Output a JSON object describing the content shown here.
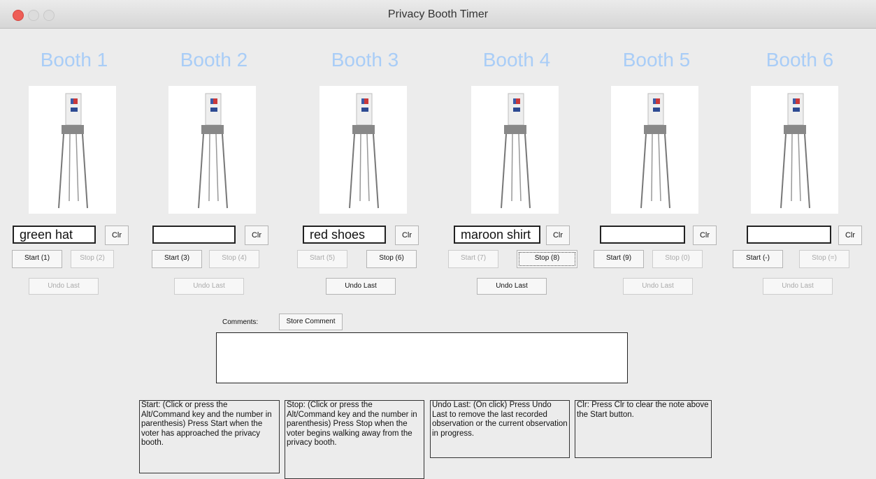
{
  "window": {
    "title": "Privacy Booth Timer"
  },
  "booths": [
    {
      "name": "Booth 1",
      "note": "green hat",
      "clr": "Clr",
      "start": "Start (1)",
      "stop": "Stop (2)",
      "undo": "Undo Last"
    },
    {
      "name": "Booth 2",
      "note": "",
      "clr": "Clr",
      "start": "Start (3)",
      "stop": "Stop (4)",
      "undo": "Undo Last"
    },
    {
      "name": "Booth 3",
      "note": "red shoes",
      "clr": "Clr",
      "start": "Start (5)",
      "stop": "Stop (6)",
      "undo": "Undo Last"
    },
    {
      "name": "Booth 4",
      "note": "maroon shirt",
      "clr": "Clr",
      "start": "Start (7)",
      "stop": "Stop (8)",
      "undo": "Undo Last"
    },
    {
      "name": "Booth 5",
      "note": "",
      "clr": "Clr",
      "start": "Start (9)",
      "stop": "Stop (0)",
      "undo": "Undo Last"
    },
    {
      "name": "Booth 6",
      "note": "",
      "clr": "Clr",
      "start": "Start (-)",
      "stop": "Stop (=)",
      "undo": "Undo Last"
    }
  ],
  "comments": {
    "label": "Comments:",
    "store_label": "Store Comment",
    "value": ""
  },
  "help": {
    "start": "Start: (Click or press the Alt/Command key and the number in parenthesis) Press Start when the voter has approached the privacy booth.",
    "stop": "Stop: (Click or press the Alt/Command key and the number in parenthesis) Press Stop when the voter begins walking away from the privacy booth.",
    "undo": "Undo Last: (On click) Press Undo Last to remove the last recorded observation or the current observation in progress.",
    "clr": "Clr: Press Clr to clear the note above the Start button."
  },
  "colors": {
    "booth_title": "#a9cdf7",
    "close": "#ee5e57",
    "min": "#dcdcdc",
    "max": "#dcdcdc"
  },
  "icons": {
    "booth_image": "voting-booth-image"
  }
}
